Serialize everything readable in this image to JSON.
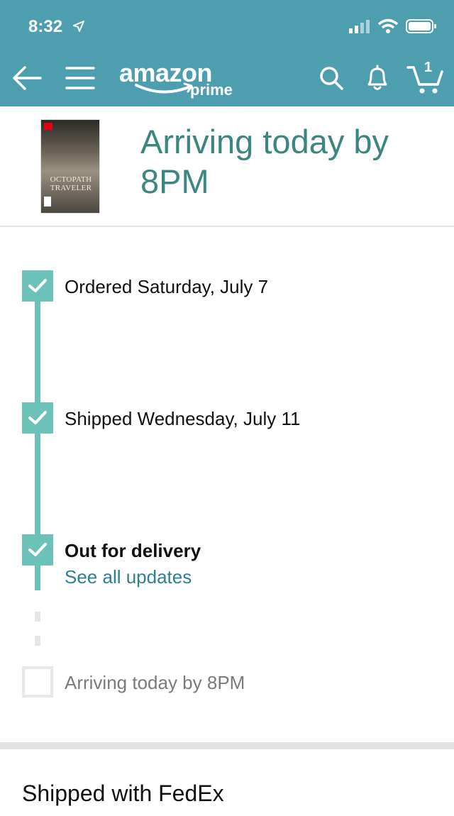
{
  "status_bar": {
    "time": "8:32"
  },
  "header": {
    "brand_word": "amazon",
    "brand_sub": "prime",
    "cart_count": "1",
    "background": "#4d9fb0"
  },
  "arrival": {
    "title": "Arriving today by 8PM",
    "product_box_title": "OCTOPATH TRAVELER"
  },
  "timeline": {
    "steps": [
      {
        "label": "Ordered Saturday, July 7",
        "state": "done"
      },
      {
        "label": "Shipped Wednesday, July 11",
        "state": "done"
      },
      {
        "label": "Out for delivery",
        "state": "current",
        "link": "See all updates"
      },
      {
        "label": "Arriving today by 8PM",
        "state": "pending"
      }
    ],
    "accent": "#6cc2b8"
  },
  "carrier": {
    "label": "Shipped with FedEx"
  }
}
